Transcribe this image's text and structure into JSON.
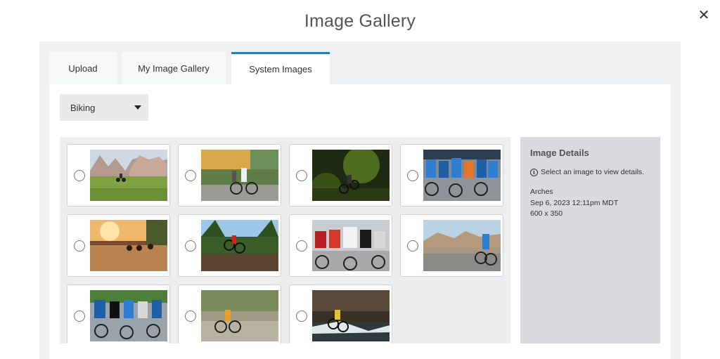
{
  "dialog": {
    "title": "Image Gallery",
    "close_icon": "close-icon"
  },
  "tabs": [
    {
      "label": "Upload",
      "active": false
    },
    {
      "label": "My Image Gallery",
      "active": false
    },
    {
      "label": "System Images",
      "active": true
    }
  ],
  "category_select": {
    "value": "Biking"
  },
  "gallery": {
    "images": [
      {
        "scene": "mountain-meadow-rider",
        "selected": false
      },
      {
        "scene": "city-street-cyclists",
        "selected": false
      },
      {
        "scene": "forest-trail-rider",
        "selected": false
      },
      {
        "scene": "peloton-blue-jerseys",
        "selected": false
      },
      {
        "scene": "sunset-road-race",
        "selected": false
      },
      {
        "scene": "wide-angle-forest-jump",
        "selected": false
      },
      {
        "scene": "racers-helmets-closeup",
        "selected": false
      },
      {
        "scene": "desert-road-rider",
        "selected": false
      },
      {
        "scene": "pack-racers-corner",
        "selected": false
      },
      {
        "scene": "motion-blur-rider",
        "selected": false
      },
      {
        "scene": "creek-crossing-rider",
        "selected": false
      }
    ]
  },
  "details": {
    "title": "Image Details",
    "hint": "Select an image to view details.",
    "name": "Arches",
    "date": "Sep 6, 2023 12:11pm MDT",
    "dimensions": "600 x 350"
  },
  "colors": {
    "accent": "#2a7da6",
    "modal_bg": "#eef0f1",
    "details_bg": "#d8dadd"
  }
}
